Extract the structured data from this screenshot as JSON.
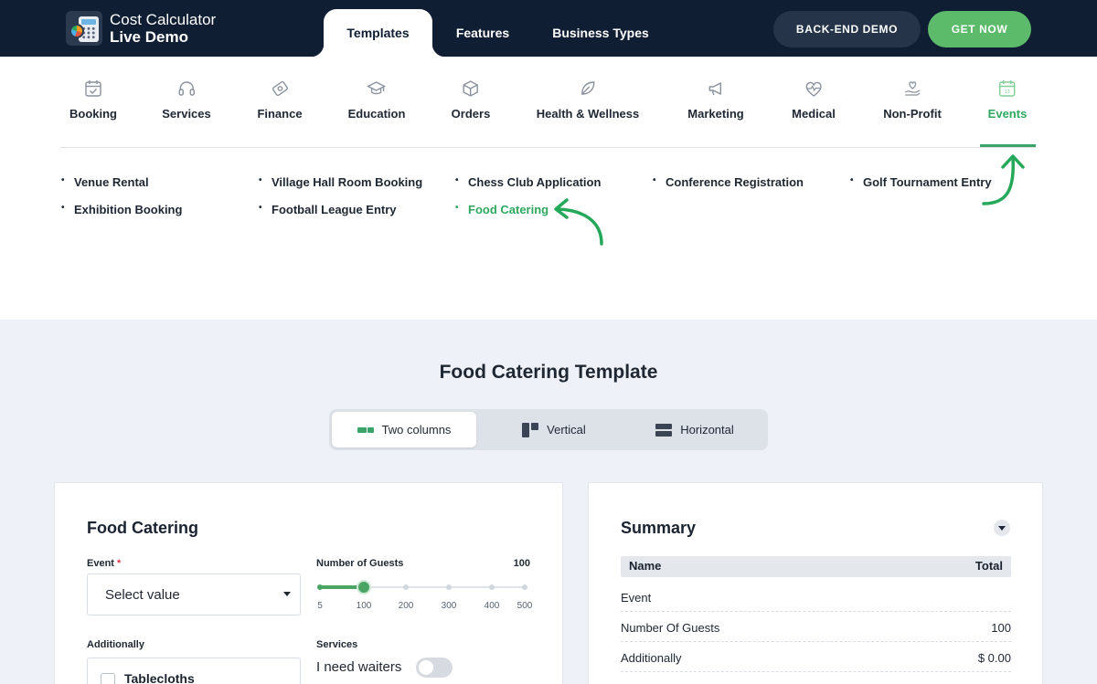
{
  "brand": {
    "line1": "Cost Calculator",
    "line2": "Live Demo"
  },
  "header": {
    "tabs": [
      {
        "label": "Templates"
      },
      {
        "label": "Features"
      },
      {
        "label": "Business Types"
      }
    ],
    "backend_demo_label": "BACK-END DEMO",
    "get_now_label": "GET NOW"
  },
  "categories": [
    {
      "label": "Booking",
      "icon": "calendar-check-icon"
    },
    {
      "label": "Services",
      "icon": "headset-icon"
    },
    {
      "label": "Finance",
      "icon": "money-icon"
    },
    {
      "label": "Education",
      "icon": "graduation-cap-icon"
    },
    {
      "label": "Orders",
      "icon": "box-icon"
    },
    {
      "label": "Health & Wellness",
      "icon": "leaf-icon"
    },
    {
      "label": "Marketing",
      "icon": "megaphone-icon"
    },
    {
      "label": "Medical",
      "icon": "heart-pulse-icon"
    },
    {
      "label": "Non-Profit",
      "icon": "hand-heart-icon"
    },
    {
      "label": "Events",
      "icon": "calendar-icon",
      "active": true
    }
  ],
  "templates": [
    {
      "label": "Venue Rental"
    },
    {
      "label": "Exhibition Booking"
    },
    {
      "label": "Village Hall Room Booking"
    },
    {
      "label": "Football League Entry"
    },
    {
      "label": "Chess Club Application"
    },
    {
      "label": "Food Catering",
      "active": true
    },
    {
      "label": "Conference Registration"
    },
    {
      "label": "Golf Tournament Entry"
    }
  ],
  "template_title": "Food Catering Template",
  "layout_switch": [
    {
      "label": "Two columns",
      "active": true
    },
    {
      "label": "Vertical"
    },
    {
      "label": "Horizontal"
    }
  ],
  "form": {
    "title": "Food Catering",
    "event_label": "Event",
    "event_required": "*",
    "event_value": "Select value",
    "guests_label": "Number of Guests",
    "guests_value": "100",
    "guests_ticks": [
      "5",
      "100",
      "200",
      "300",
      "400",
      "500"
    ],
    "additionally_label": "Additionally",
    "tablecloths_label": "Tablecloths",
    "services_label": "Services",
    "waiters_label": "I need waiters"
  },
  "summary": {
    "title": "Summary",
    "col_name": "Name",
    "col_total": "Total",
    "rows": [
      {
        "name": "Event",
        "value": ""
      },
      {
        "name": "Number Of Guests",
        "value": "100"
      },
      {
        "name": "Additionally",
        "value": "$ 0.00"
      }
    ]
  },
  "colors": {
    "accent": "#5cbb6a",
    "active_text": "#2ea860",
    "header_bg": "#0f1e33"
  }
}
